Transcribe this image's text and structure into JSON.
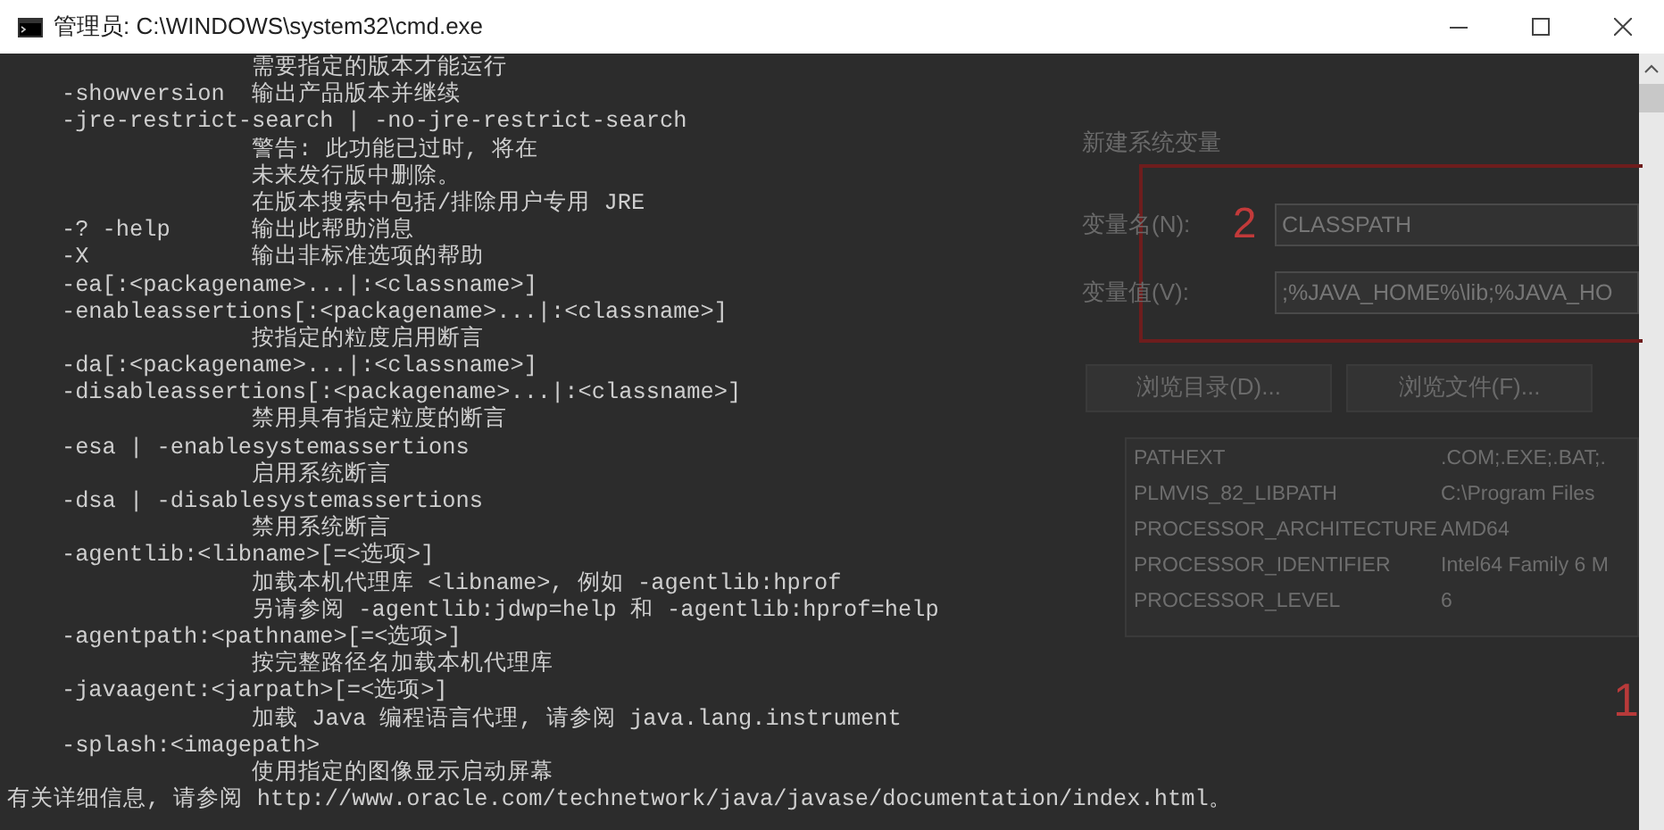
{
  "window": {
    "title": "管理员: C:\\WINDOWS\\system32\\cmd.exe"
  },
  "console_lines": [
    "                  需要指定的版本才能运行",
    "    -showversion  输出产品版本并继续",
    "    -jre-restrict-search | -no-jre-restrict-search",
    "                  警告: 此功能已过时, 将在",
    "                  未来发行版中删除。",
    "                  在版本搜索中包括/排除用户专用 JRE",
    "    -? -help      输出此帮助消息",
    "    -X            输出非标准选项的帮助",
    "    -ea[:<packagename>...|:<classname>]",
    "    -enableassertions[:<packagename>...|:<classname>]",
    "                  按指定的粒度启用断言",
    "    -da[:<packagename>...|:<classname>]",
    "    -disableassertions[:<packagename>...|:<classname>]",
    "                  禁用具有指定粒度的断言",
    "    -esa | -enablesystemassertions",
    "                  启用系统断言",
    "    -dsa | -disablesystemassertions",
    "                  禁用系统断言",
    "    -agentlib:<libname>[=<选项>]",
    "                  加载本机代理库 <libname>, 例如 -agentlib:hprof",
    "                  另请参阅 -agentlib:jdwp=help 和 -agentlib:hprof=help",
    "    -agentpath:<pathname>[=<选项>]",
    "                  按完整路径名加载本机代理库",
    "    -javaagent:<jarpath>[=<选项>]",
    "                  加载 Java 编程语言代理, 请参阅 java.lang.instrument",
    "    -splash:<imagepath>",
    "                  使用指定的图像显示启动屏幕",
    "有关详细信息, 请参阅 http://www.oracle.com/technetwork/java/javase/documentation/index.html。"
  ],
  "background_dialog": {
    "heading": "新建系统变量",
    "marker": "2",
    "fields": [
      {
        "label": "变量名(N):",
        "value": "CLASSPATH"
      },
      {
        "label": "变量值(V):",
        "value": ";%JAVA_HOME%\\lib;%JAVA_HO"
      }
    ],
    "buttons": [
      "浏览目录(D)...",
      "浏览文件(F)..."
    ],
    "variables": [
      {
        "name": "PATHEXT",
        "value": ".COM;.EXE;.BAT;."
      },
      {
        "name": "PLMVIS_82_LIBPATH",
        "value": "C:\\Program Files"
      },
      {
        "name": "PROCESSOR_ARCHITECTURE",
        "value": "AMD64"
      },
      {
        "name": "PROCESSOR_IDENTIFIER",
        "value": "Intel64 Family 6 M"
      },
      {
        "name": "PROCESSOR_LEVEL",
        "value": "6"
      }
    ],
    "marker_2": "1"
  }
}
